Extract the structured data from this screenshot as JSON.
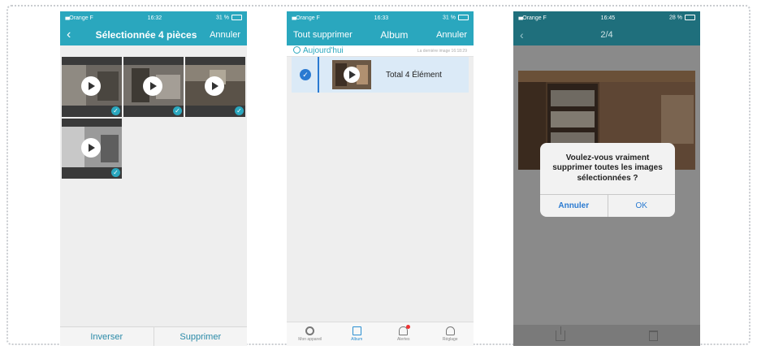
{
  "phone1": {
    "status": {
      "carrier": "Orange F",
      "time": "16:32",
      "battery": "31 %"
    },
    "nav": {
      "back": "‹",
      "title": "Sélectionnée 4 pièces",
      "cancel": "Annuler"
    },
    "bottom": {
      "invert": "Inverser",
      "delete": "Supprimer"
    },
    "thumb_check": "✓"
  },
  "phone2": {
    "status": {
      "carrier": "Orange F",
      "time": "16:33",
      "battery": "31 %"
    },
    "nav": {
      "left": "Tout supprimer",
      "title": "Album",
      "right": "Annuler"
    },
    "section": {
      "today": "Aujourd'hui",
      "last": "La dernière image 16:18:29"
    },
    "row": {
      "check": "✓",
      "total": "Total 4 Élément"
    },
    "tabs": [
      {
        "label": "Mon appareil"
      },
      {
        "label": "Album"
      },
      {
        "label": "Alertes"
      },
      {
        "label": "Réglage"
      }
    ]
  },
  "phone3": {
    "status": {
      "carrier": "Orange F",
      "time": "16:45",
      "battery": "28 %"
    },
    "nav": {
      "back": "‹",
      "title": "2/4"
    },
    "dialog": {
      "message": "Voulez-vous vraiment supprimer toutes les images sélectionnées ?",
      "cancel": "Annuler",
      "ok": "OK"
    }
  },
  "colors": {
    "teal": "#2aa7be",
    "blue": "#2a7ad1",
    "alert_dot": "#ee3333"
  }
}
